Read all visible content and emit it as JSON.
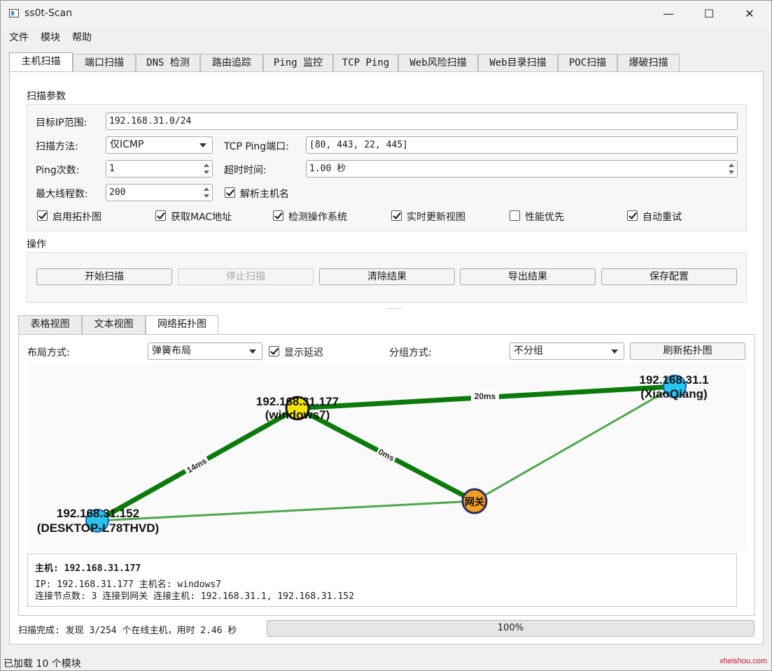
{
  "window": {
    "title": "ss0t-Scan",
    "minimize": "—",
    "maximize": "☐",
    "close": "✕"
  },
  "menu": {
    "file": "文件",
    "module": "模块",
    "help": "帮助"
  },
  "tabs": [
    "主机扫描",
    "端口扫描",
    "DNS 检测",
    "路由追踪",
    "Ping 监控",
    "TCP Ping",
    "Web风险扫描",
    "Web目录扫描",
    "POC扫描",
    "爆破扫描"
  ],
  "params": {
    "section": "扫描参数",
    "target_label": "目标IP范围:",
    "target_value": "192.168.31.0/24",
    "method_label": "扫描方法:",
    "method_value": "仅ICMP",
    "tcp_port_label": "TCP Ping端口:",
    "tcp_port_value": "[80, 443, 22, 445]",
    "ping_count_label": "Ping次数:",
    "ping_count_value": "1",
    "timeout_label": "超时时间:",
    "timeout_value": "1.00 秒",
    "threads_label": "最大线程数:",
    "threads_value": "200",
    "resolve_label": "解析主机名",
    "opts": [
      {
        "label": "启用拓扑图",
        "checked": true
      },
      {
        "label": "获取MAC地址",
        "checked": true
      },
      {
        "label": "检测操作系统",
        "checked": true
      },
      {
        "label": "实时更新视图",
        "checked": true
      },
      {
        "label": "性能优先",
        "checked": false
      },
      {
        "label": "自动重试",
        "checked": true
      }
    ]
  },
  "actions": {
    "section": "操作",
    "start": "开始扫描",
    "stop": "停止扫描",
    "clear": "清除结果",
    "export": "导出结果",
    "save": "保存配置"
  },
  "subtabs": [
    "表格视图",
    "文本视图",
    "网络拓扑图"
  ],
  "topo": {
    "layout_label": "布局方式:",
    "layout_value": "弹簧布局",
    "show_latency": "显示延迟",
    "group_label": "分组方式:",
    "group_value": "不分组",
    "refresh": "刷新拓扑图",
    "nodes": {
      "n177": {
        "ip": "192.168.31.177",
        "name": "(windows7)"
      },
      "n1": {
        "ip": "192.168.31.1",
        "name": "(XiaoQiang)"
      },
      "n152": {
        "ip": "192.168.31.152",
        "name": "(DESKTOP-L78THVD)"
      },
      "gw": {
        "label": "网关"
      }
    },
    "edges": {
      "e1": "20ms",
      "e2": "14ms",
      "e3": "0ms"
    }
  },
  "info": {
    "title": "主机: 192.168.31.177",
    "line1": "IP: 192.168.31.177  主机名: windows7",
    "line2": "连接节点数: 3  连接到网关 连接主机: 192.168.31.1, 192.168.31.152"
  },
  "status": {
    "scan_done": "扫描完成: 发现 3/254 个在线主机，用时 2.46 秒",
    "progress": 100,
    "progress_text": "100%",
    "bottom": "已加载 10 个模块"
  },
  "watermark": "xheishou.com"
}
